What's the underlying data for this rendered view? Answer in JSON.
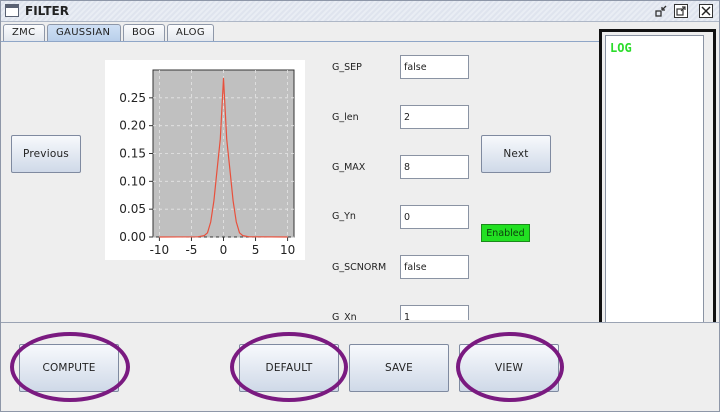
{
  "window": {
    "title": "FILTER"
  },
  "tabs": [
    {
      "label": "ZMC",
      "active": false
    },
    {
      "label": "GAUSSIAN",
      "active": true
    },
    {
      "label": "BOG",
      "active": false
    },
    {
      "label": "ALOG",
      "active": false
    }
  ],
  "nav": {
    "previous_label": "Previous",
    "next_label": "Next"
  },
  "fields": [
    {
      "label": "G_SEP",
      "value": "false"
    },
    {
      "label": "G_len",
      "value": "2"
    },
    {
      "label": "G_MAX",
      "value": "8"
    },
    {
      "label": "G_Yn",
      "value": "0"
    },
    {
      "label": "G_SCNORM",
      "value": "false"
    },
    {
      "label": "G_Xn",
      "value": "1"
    }
  ],
  "status": {
    "enabled_label": "Enabled",
    "enabled_color": "#22e022"
  },
  "log": {
    "title": "LOG",
    "title_color": "#2bdc2b"
  },
  "actions": {
    "compute_label": "COMPUTE",
    "default_label": "DEFAULT",
    "save_label": "SAVE",
    "view_label": "VIEW"
  },
  "highlight_color": "#7a1a80",
  "chart_data": {
    "type": "line",
    "title": "",
    "xlabel": "",
    "ylabel": "",
    "xlim": [
      -11,
      11
    ],
    "ylim": [
      0,
      0.3
    ],
    "xticks": [
      -10,
      -5,
      0,
      5,
      10
    ],
    "yticks": [
      0.0,
      0.05,
      0.1,
      0.15,
      0.2,
      0.25
    ],
    "xtick_labels": [
      "-10",
      "-5",
      "0",
      "5",
      "10"
    ],
    "ytick_labels": [
      "0.00",
      "0.05",
      "0.10",
      "0.15",
      "0.20",
      "0.25"
    ],
    "grid": true,
    "background": "#c0c0c0",
    "series": [
      {
        "color": "#e8503c",
        "x": [
          -10,
          -4,
          -3,
          -2.5,
          -2,
          -1.5,
          -1,
          -0.5,
          0,
          0.5,
          1,
          1.5,
          2,
          2.5,
          3,
          4,
          10
        ],
        "y": [
          0,
          0.0004,
          0.0025,
          0.0075,
          0.027,
          0.065,
          0.121,
          0.176,
          0.285,
          0.176,
          0.121,
          0.065,
          0.027,
          0.0075,
          0.0025,
          0.0004,
          0
        ]
      }
    ]
  }
}
